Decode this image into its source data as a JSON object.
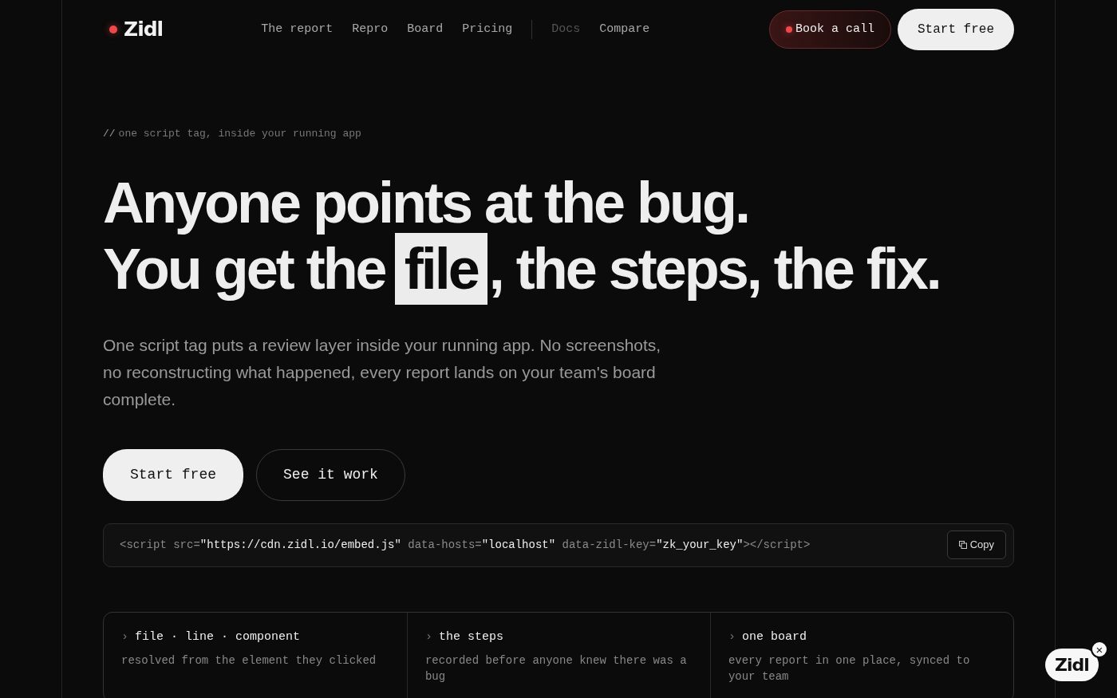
{
  "brand": {
    "name": "Zidl"
  },
  "nav": [
    {
      "label": "The report",
      "dimmed": false
    },
    {
      "label": "Repro",
      "dimmed": false
    },
    {
      "label": "Board",
      "dimmed": false
    },
    {
      "label": "Pricing",
      "dimmed": false,
      "divider_after": true
    },
    {
      "label": "Docs",
      "dimmed": true
    },
    {
      "label": "Compare",
      "dimmed": false
    }
  ],
  "header_buttons": [
    {
      "label": "Book a call",
      "kind": "call"
    },
    {
      "label": "Start free",
      "kind": "primary"
    }
  ],
  "eyebrow": {
    "mark": "//",
    "text": "one script tag, inside your running app"
  },
  "headline": {
    "line_1": "Anyone points at the bug.",
    "line_2_before": "You get the ",
    "line_2_highlight": "file",
    "line_2_after": ", the steps, the fix."
  },
  "lead": "One script tag puts a review layer inside your running app. No screenshots, no reconstructing what happened, every report lands on your team's board complete.",
  "cta": [
    {
      "label": "Start free",
      "kind": "primary"
    },
    {
      "label": "See it work",
      "kind": "outline"
    }
  ],
  "snippet": {
    "tokens": [
      {
        "text": "<script ",
        "kind": "syntax"
      },
      {
        "text": "src=",
        "kind": "syntax"
      },
      {
        "text": "\"https://cdn.zidl.io/embed.js\"",
        "kind": "value"
      },
      {
        "text": " data-hosts=",
        "kind": "syntax"
      },
      {
        "text": "\"localhost\"",
        "kind": "value"
      },
      {
        "text": " data-zidl-key=",
        "kind": "syntax"
      },
      {
        "text": "\"zk_your_key\"",
        "kind": "value"
      },
      {
        "text": "></script>",
        "kind": "syntax"
      }
    ],
    "copy_button": "Copy"
  },
  "features": [
    {
      "marker": "›",
      "title": "file · line · component",
      "text": "resolved from the element they clicked"
    },
    {
      "marker": "›",
      "title": "the steps",
      "text": "recorded before anyone knew there was a bug"
    },
    {
      "marker": "›",
      "title": "one board",
      "text": "every report in one place, synced to your team"
    }
  ],
  "widget": {
    "label": "Zidl",
    "close": "×"
  }
}
